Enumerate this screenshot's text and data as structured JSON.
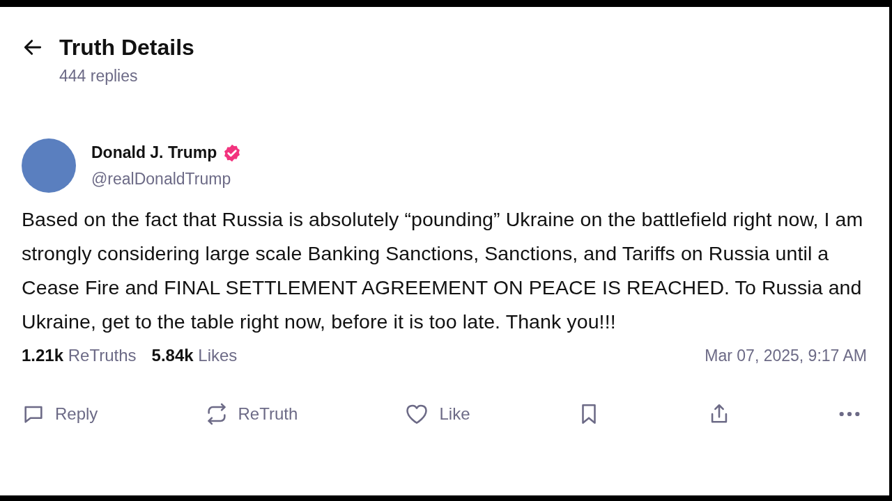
{
  "header": {
    "title": "Truth Details",
    "subtitle": "444 replies"
  },
  "post": {
    "author": "Donald J. Trump",
    "verified": true,
    "handle": "@realDonaldTrump",
    "text": "Based on the fact that Russia is absolutely “pounding” Ukraine on the battlefield right now, I am strongly considering large scale Banking Sanctions, Sanctions, and Tariffs on Russia until a Cease Fire and FINAL SETTLEMENT AGREEMENT ON PEACE IS REACHED. To Russia and Ukraine, get to the table right now, before it is too late. Thank you!!!",
    "stats": [
      {
        "count": "1.21k",
        "label": "ReTruths"
      },
      {
        "count": "5.84k",
        "label": "Likes"
      }
    ],
    "timestamp": "Mar 07, 2025, 9:17 AM"
  },
  "actions": [
    {
      "kind": "reply",
      "label": "Reply"
    },
    {
      "kind": "retruth",
      "label": "ReTruth"
    },
    {
      "kind": "like",
      "label": "Like"
    },
    {
      "kind": "bookmark"
    },
    {
      "kind": "share"
    },
    {
      "kind": "more"
    }
  ]
}
